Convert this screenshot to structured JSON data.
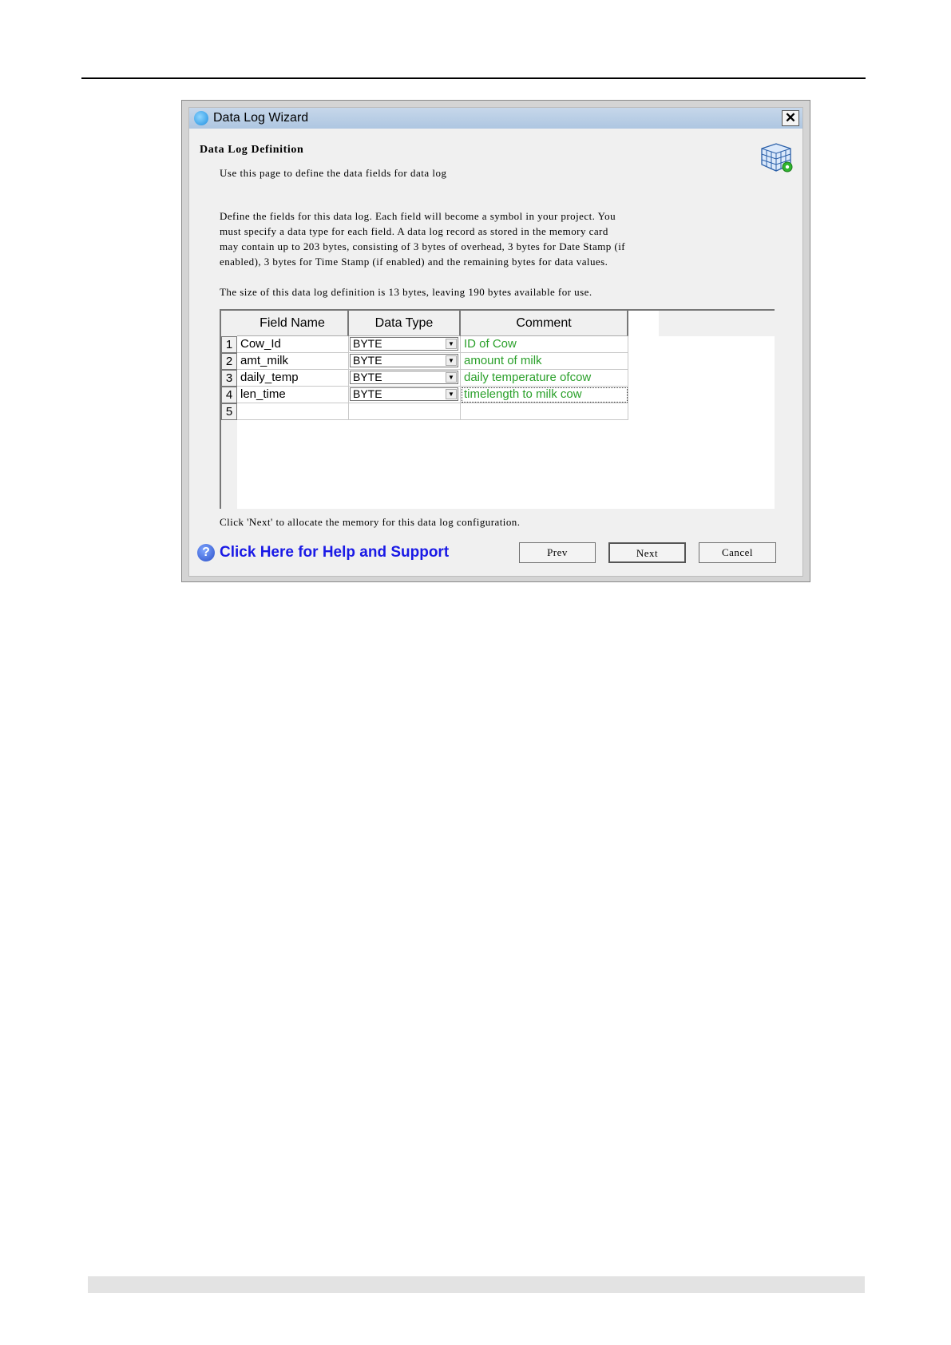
{
  "window": {
    "title": "Data Log Wizard",
    "close_label": "✕"
  },
  "page": {
    "heading": "Data Log Definition",
    "subtitle": "Use this page to define the data fields for data log",
    "description_lines": [
      "Define the fields for this data log. Each field will become a symbol in your project. You",
      "must specify a data type for each field. A data log record as stored in the memory card",
      "may contain up to 203 bytes, consisting of 3 bytes of overhead, 3 bytes for Date Stamp (if",
      "enabled), 3 bytes for Time Stamp (if enabled) and the remaining bytes for data values."
    ],
    "size_line": "The size of this data log definition is 13 bytes, leaving 190 bytes available for use.",
    "footer_text": "Click 'Next' to allocate the memory for this data log configuration."
  },
  "grid": {
    "columns": [
      "Field Name",
      "Data Type",
      "Comment"
    ],
    "rows": [
      {
        "num": "1",
        "field": "Cow_Id",
        "type": "BYTE",
        "comment": "ID of Cow"
      },
      {
        "num": "2",
        "field": "amt_milk",
        "type": "BYTE",
        "comment": "amount of milk"
      },
      {
        "num": "3",
        "field": "daily_temp",
        "type": "BYTE",
        "comment": "daily temperature ofcow"
      },
      {
        "num": "4",
        "field": "len_time",
        "type": "BYTE",
        "comment": "timelength to milk cow"
      },
      {
        "num": "5",
        "field": "",
        "type": "",
        "comment": ""
      }
    ],
    "dropdown_icon": "chevron-down-icon"
  },
  "help": {
    "label": "Click Here for Help and Support",
    "icon": "question-icon"
  },
  "buttons": {
    "prev": "Prev",
    "next": "Next",
    "cancel": "Cancel"
  },
  "colors": {
    "comment": "#2aa02a",
    "help_link": "#1a1ae6",
    "titlebar": "#aec6e1"
  }
}
